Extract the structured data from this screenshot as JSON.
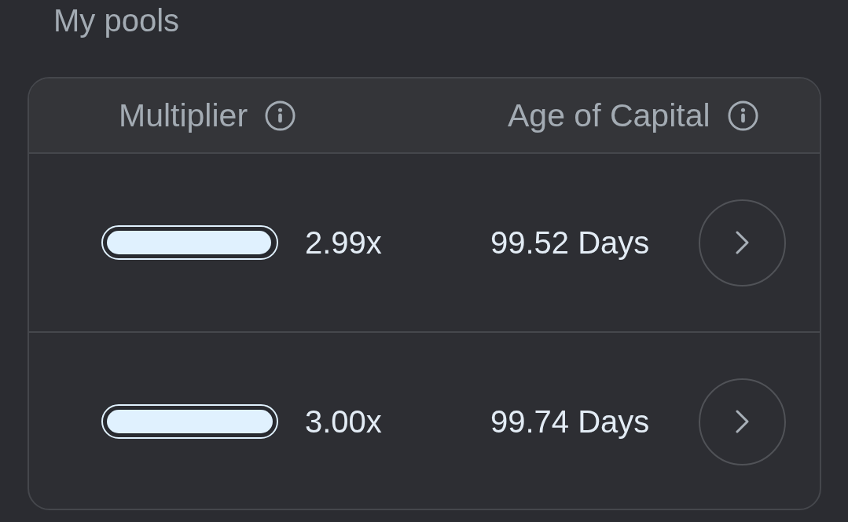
{
  "title": "My pools",
  "table": {
    "columns": [
      {
        "label": "Multiplier"
      },
      {
        "label": "Age of Capital"
      }
    ],
    "rows": [
      {
        "multiplier": {
          "level": 0.99,
          "reading": "2.99x"
        },
        "age": "99.52 Days"
      },
      {
        "multiplier": {
          "level": 1,
          "reading": "3.00x"
        },
        "age": "99.74 Days"
      }
    ]
  }
}
